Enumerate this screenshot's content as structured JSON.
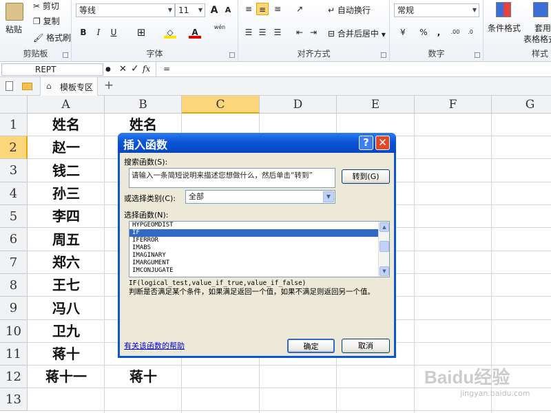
{
  "ribbon": {
    "clipboard": {
      "paste": "粘贴",
      "cut": "剪切",
      "copy": "复制",
      "format_painter": "格式刷",
      "label": "剪贴板"
    },
    "font": {
      "name": "等线",
      "size": "11",
      "grow": "A",
      "shrink": "A",
      "bold": "B",
      "italic": "I",
      "underline": "U",
      "label": "字体",
      "color_letter": "A",
      "wen": "wén"
    },
    "alignment": {
      "wrap": "自动换行",
      "merge": "合并后居中",
      "label": "对齐方式"
    },
    "number": {
      "format": "常规",
      "percent": "%",
      "comma": ",",
      "label": "数字"
    },
    "styles": {
      "conditional": "条件格式",
      "apply1": "套用",
      "apply2": "表格格式",
      "label": "样式"
    }
  },
  "formula_bar": {
    "name_box": "REPT",
    "fx": "fx",
    "content": "="
  },
  "tabs": {
    "template": "模板专区",
    "add": "+"
  },
  "columns": [
    "A",
    "B",
    "C",
    "D",
    "E",
    "F",
    "G"
  ],
  "rows": [
    "1",
    "2",
    "3",
    "4",
    "5",
    "6",
    "7",
    "8",
    "9",
    "10",
    "11",
    "12",
    "13"
  ],
  "cells": {
    "colA": [
      "姓名",
      "赵一",
      "钱二",
      "孙三",
      "李四",
      "周五",
      "郑六",
      "王七",
      "冯八",
      "卫九",
      "蒋十",
      "蒋十一"
    ],
    "b1": "姓名",
    "b12": "蒋十"
  },
  "dialog": {
    "title": "插入函数",
    "help_glyph": "?",
    "close_glyph": "✕",
    "search_label": "搜索函数(S):",
    "search_value": "请输入一条简短说明来描述您想做什么，然后单击“转到”",
    "goto_button": "转到(G)",
    "category_label": "或选择类别(C):",
    "category_value": "全部",
    "select_label": "选择函数(N):",
    "functions": [
      "HYPGEOMDIST",
      "IF",
      "IFERROR",
      "IMABS",
      "IMAGINARY",
      "IMARGUMENT",
      "IMCONJUGATE"
    ],
    "selected_function": "IF",
    "syntax": "IF(logical_test,value_if_true,value_if_false)",
    "description": "判断是否满足某个条件，如果满足返回一个值，如果不满足则返回另一个值。",
    "help_link": "有关该函数的帮助",
    "ok": "确定",
    "cancel": "取消"
  },
  "watermark": {
    "brand": "Baidu经验",
    "url": "jingyan.baidu.com"
  }
}
